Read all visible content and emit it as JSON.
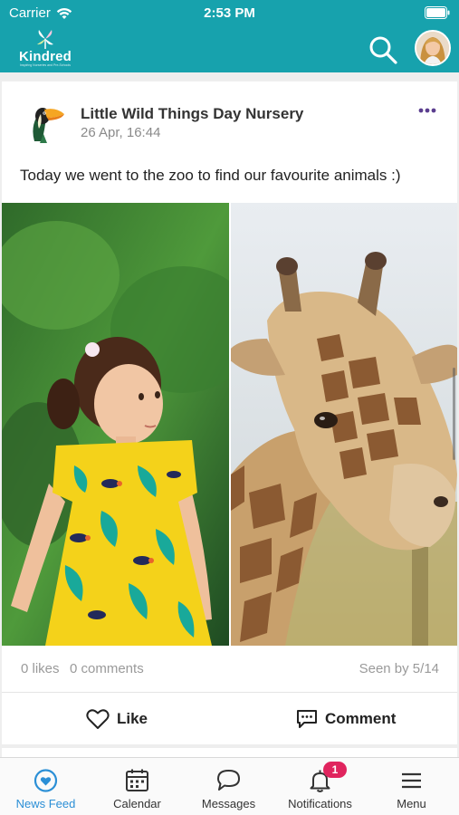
{
  "status_bar": {
    "carrier": "Carrier",
    "time": "2:53 PM"
  },
  "app": {
    "brand": "Kindred",
    "tagline": "Inspiring Nurseries and Pre-Schools"
  },
  "post": {
    "author": "Little Wild Things Day Nursery",
    "date": "26 Apr, 16:44",
    "text": "Today we went to the zoo to find our favourite animals :)",
    "likes": "0 likes",
    "comments": "0 comments",
    "seen": "Seen by 5/14",
    "like_label": "Like",
    "comment_label": "Comment"
  },
  "tabs": [
    {
      "label": "News Feed",
      "icon": "heart-circle-icon",
      "active": true
    },
    {
      "label": "Calendar",
      "icon": "calendar-icon"
    },
    {
      "label": "Messages",
      "icon": "speech-bubble-icon"
    },
    {
      "label": "Notifications",
      "icon": "bell-icon",
      "badge": "1"
    },
    {
      "label": "Menu",
      "icon": "hamburger-icon"
    }
  ],
  "colors": {
    "brand": "#17a2ad",
    "active_tab": "#2b8fd6",
    "badge": "#e0245e",
    "more_dots": "#5b3e8f"
  }
}
